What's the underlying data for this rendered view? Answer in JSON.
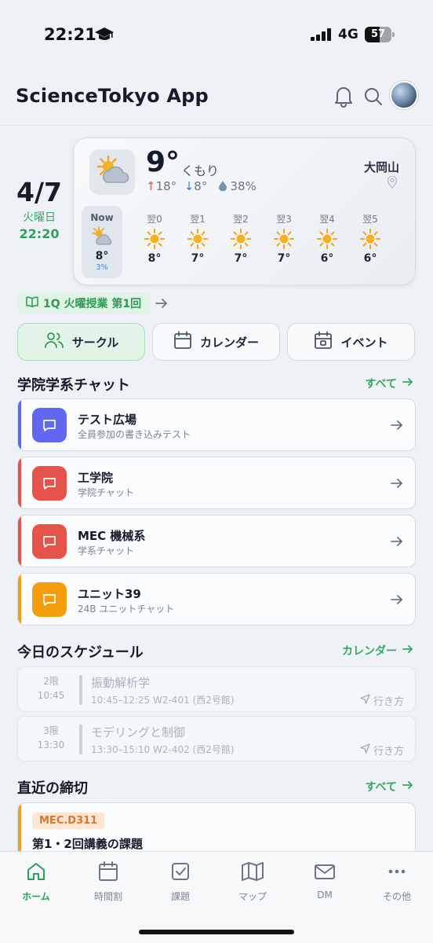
{
  "status": {
    "time": "22:21",
    "network": "4G",
    "battery": "57",
    "battery_level": 0.57
  },
  "header": {
    "title": "ScienceTokyo App",
    "icons": [
      "bell-icon",
      "search-icon",
      "avatar"
    ]
  },
  "date": {
    "main": "4/7",
    "weekday": "火曜日",
    "time": "22:20"
  },
  "weather": {
    "temp": "9°",
    "condition": "くもり",
    "high": "18°",
    "low": "8°",
    "rain": "38%",
    "location": "大岡山",
    "forecast": [
      {
        "label": "Now",
        "temp": "8°",
        "rain": "3%",
        "icon": "partly-cloudy-icon"
      },
      {
        "label": "翌0",
        "temp": "8°",
        "icon": "sun-icon"
      },
      {
        "label": "翌1",
        "temp": "7°",
        "icon": "sun-icon"
      },
      {
        "label": "翌2",
        "temp": "7°",
        "icon": "sun-icon"
      },
      {
        "label": "翌3",
        "temp": "7°",
        "icon": "sun-icon"
      },
      {
        "label": "翌4",
        "temp": "6°",
        "icon": "sun-icon"
      },
      {
        "label": "翌5",
        "temp": "6°",
        "icon": "sun-icon"
      }
    ]
  },
  "lesson_chip": {
    "label": "1Q 火曜授業 第1回"
  },
  "quick": [
    {
      "label": "サークル",
      "icon": "people-icon"
    },
    {
      "label": "カレンダー",
      "icon": "calendar-icon"
    },
    {
      "label": "イベント",
      "icon": "event-calendar-icon"
    }
  ],
  "chat_section": {
    "title": "学院学系チャット",
    "link": "すべて",
    "items": [
      {
        "name": "テスト広場",
        "sub": "全員参加の書き込みテスト",
        "color": "#6366f1"
      },
      {
        "name": "工学院",
        "sub": "学院チャット",
        "color": "#e5534b"
      },
      {
        "name": "MEC 機械系",
        "sub": "学系チャット",
        "color": "#e5534b"
      },
      {
        "name": "ユニット39",
        "sub": "24B ユニットチャット",
        "color": "#f59e0b"
      }
    ]
  },
  "schedule_section": {
    "title": "今日のスケジュール",
    "link": "カレンダー",
    "items": [
      {
        "period": "2限",
        "start": "10:45",
        "title": "振動解析学",
        "detail": "10:45–12:25  W2-401 (西2号館)",
        "go": "行き方"
      },
      {
        "period": "3限",
        "start": "13:30",
        "title": "モデリングと制御",
        "detail": "13:30–15:10  W2-402 (西2号館)",
        "go": "行き方"
      }
    ]
  },
  "deadline_section": {
    "title": "直近の締切",
    "link": "すべて",
    "item": {
      "tag": "MEC.D311",
      "title": "第1・2回講義の課題"
    }
  },
  "tabs": [
    {
      "label": "ホーム",
      "icon": "home-icon",
      "active": true
    },
    {
      "label": "時間割",
      "icon": "timetable-icon"
    },
    {
      "label": "課題",
      "icon": "task-check-icon"
    },
    {
      "label": "マップ",
      "icon": "map-icon"
    },
    {
      "label": "DM",
      "icon": "mail-icon"
    },
    {
      "label": "その他",
      "icon": "more-icon"
    }
  ],
  "colors": {
    "accent": "#2e9f58",
    "chat_purple": "#6366f1",
    "chat_red": "#e5534b",
    "chat_orange": "#f59e0b",
    "deadline": "#f0a020"
  }
}
